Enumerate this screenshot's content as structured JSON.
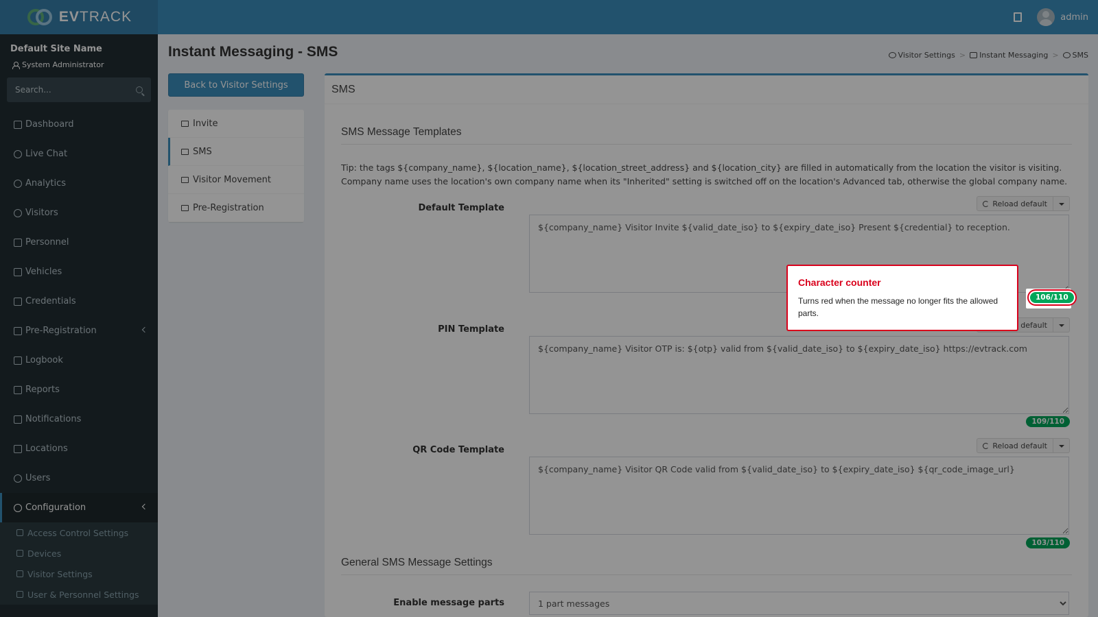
{
  "brand": {
    "name_bold": "EV",
    "name_rest": "TRACK"
  },
  "topbar": {
    "user": "admin"
  },
  "sidebar": {
    "site_name": "Default Site Name",
    "role": "System Administrator",
    "search_placeholder": "Search...",
    "items": [
      {
        "label": "Dashboard",
        "icon": "dashboard-icon"
      },
      {
        "label": "Live Chat",
        "icon": "headset-icon"
      },
      {
        "label": "Analytics",
        "icon": "target-icon"
      },
      {
        "label": "Visitors",
        "icon": "eye-icon"
      },
      {
        "label": "Personnel",
        "icon": "personnel-icon"
      },
      {
        "label": "Vehicles",
        "icon": "car-icon"
      },
      {
        "label": "Credentials",
        "icon": "id-card-icon"
      },
      {
        "label": "Pre-Registration",
        "icon": "arrows-icon"
      },
      {
        "label": "Logbook",
        "icon": "book-icon"
      },
      {
        "label": "Reports",
        "icon": "chart-icon"
      },
      {
        "label": "Notifications",
        "icon": "comments-icon"
      },
      {
        "label": "Locations",
        "icon": "map-icon"
      },
      {
        "label": "Users",
        "icon": "user-icon"
      },
      {
        "label": "Configuration",
        "icon": "gear-icon"
      }
    ],
    "sub_items": [
      {
        "label": "Access Control Settings",
        "icon": "lock-icon"
      },
      {
        "label": "Devices",
        "icon": "chip-icon"
      },
      {
        "label": "Visitor Settings",
        "icon": "eye-icon"
      },
      {
        "label": "User & Personnel Settings",
        "icon": "users-gear-icon"
      }
    ]
  },
  "page": {
    "title": "Instant Messaging - SMS",
    "breadcrumb": [
      "Visitor Settings",
      "Instant Messaging",
      "SMS"
    ],
    "back_button": "Back to Visitor Settings",
    "tabs": [
      "Invite",
      "SMS",
      "Visitor Movement",
      "Pre-Registration"
    ]
  },
  "box": {
    "title": "SMS",
    "templates_title": "SMS Message Templates",
    "tip": "Tip: the tags ${company_name}, ${location_name}, ${location_street_address} and ${location_city} are filled in automatically from the location the visitor is visiting. Company name uses the location's own company name when its \"Inherited\" setting is switched off on the location's Advanced tab, otherwise the global company name.",
    "reload_label": "Reload default",
    "templates": [
      {
        "label": "Default Template",
        "value": "${company_name} Visitor Invite ${valid_date_iso} to ${expiry_date_iso} Present ${credential} to reception.",
        "counter": "106/110"
      },
      {
        "label": "PIN Template",
        "value": "${company_name} Visitor OTP is: ${otp} valid from ${valid_date_iso} to ${expiry_date_iso} https://evtrack.com",
        "counter": "109/110"
      },
      {
        "label": "QR Code Template",
        "value": "${company_name} Visitor QR Code valid from ${valid_date_iso} to ${expiry_date_iso} ${qr_code_image_url}",
        "counter": "103/110"
      }
    ],
    "general_title": "General SMS Message Settings",
    "parts_label": "Enable message parts",
    "parts_value": "1 part messages"
  },
  "popover": {
    "title": "Character counter",
    "body": "Turns red when the message no longer fits the allowed parts."
  },
  "colors": {
    "accent": "#3c8dbc",
    "counter_ok": "#00a65a",
    "highlight": "#d9001b"
  }
}
